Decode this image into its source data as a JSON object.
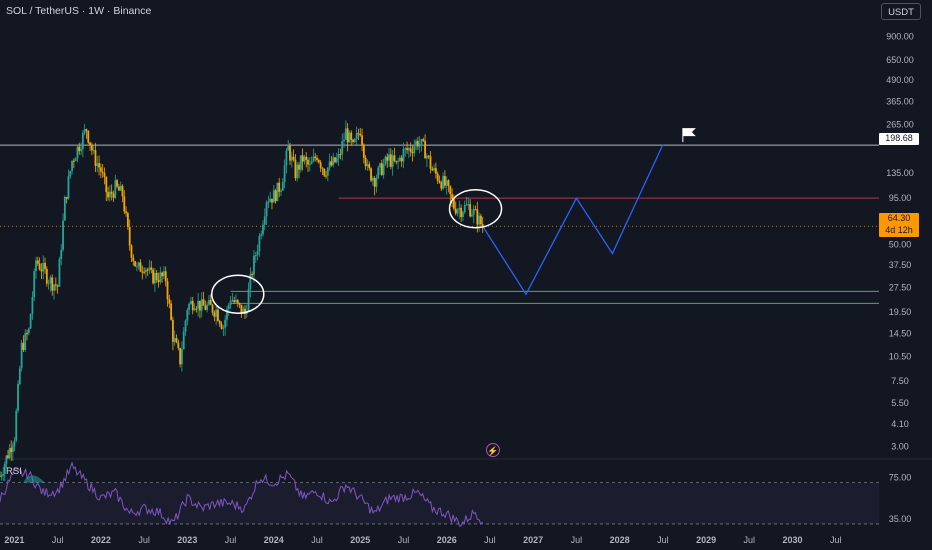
{
  "header": {
    "title": "SOL / TetherUS · 1W · Binance",
    "currency_button": "USDT"
  },
  "indicator": {
    "rsi_label": "RSI"
  },
  "price_tags": {
    "level": "198.68",
    "last": "64.30",
    "countdown": "4d 12h"
  },
  "price_axis": [
    "900.00",
    "650.00",
    "490.00",
    "365.00",
    "265.00",
    "198.68",
    "135.00",
    "95.00",
    "70.00",
    "50.00",
    "37.50",
    "27.50",
    "19.50",
    "14.50",
    "10.50",
    "7.50",
    "5.50",
    "4.10",
    "3.00"
  ],
  "rsi_axis": [
    "75.00",
    "35.00"
  ],
  "time_axis": [
    "2021",
    "Jul",
    "2022",
    "Jul",
    "2023",
    "Jul",
    "2024",
    "Jul",
    "2025",
    "Jul",
    "2026",
    "Jul",
    "2027",
    "Jul",
    "2028",
    "Jul",
    "2029",
    "Jul",
    "2030",
    "Jul"
  ],
  "colors": {
    "background": "#131722",
    "up": "#26a69a",
    "down": "#f7a600",
    "projection": "#2962ff",
    "resistance": "#b2384d",
    "support": "#4caf50",
    "rsi": "#7e57c2",
    "level_line": "#b2b5be"
  },
  "chart_data": {
    "type": "candlestick",
    "symbol": "SOL / TetherUS",
    "interval": "1W",
    "exchange": "Binance",
    "scale": "log",
    "price_ylim": [
      2.6,
      1100
    ],
    "x_range": [
      "2020-11",
      "2031-01"
    ],
    "series": [
      {
        "name": "SOL / TetherUS",
        "points": [
          [
            "2020-11",
            2.0
          ],
          [
            "2021-01",
            3.5
          ],
          [
            "2021-02",
            12
          ],
          [
            "2021-03",
            15
          ],
          [
            "2021-04",
            40
          ],
          [
            "2021-05",
            35
          ],
          [
            "2021-06",
            30
          ],
          [
            "2021-07",
            28
          ],
          [
            "2021-08",
            90
          ],
          [
            "2021-09",
            160
          ],
          [
            "2021-10",
            200
          ],
          [
            "2021-11",
            250
          ],
          [
            "2021-12",
            170
          ],
          [
            "2022-01",
            140
          ],
          [
            "2022-02",
            95
          ],
          [
            "2022-03",
            110
          ],
          [
            "2022-04",
            100
          ],
          [
            "2022-05",
            50
          ],
          [
            "2022-06",
            35
          ],
          [
            "2022-07",
            38
          ],
          [
            "2022-08",
            32
          ],
          [
            "2022-09",
            32
          ],
          [
            "2022-10",
            31
          ],
          [
            "2022-11",
            14
          ],
          [
            "2022-12",
            10
          ],
          [
            "2023-01",
            21
          ],
          [
            "2023-02",
            23
          ],
          [
            "2023-03",
            21
          ],
          [
            "2023-04",
            21
          ],
          [
            "2023-05",
            20
          ],
          [
            "2023-06",
            16
          ],
          [
            "2023-07",
            24
          ],
          [
            "2023-08",
            21
          ],
          [
            "2023-09",
            19
          ],
          [
            "2023-10",
            35
          ],
          [
            "2023-11",
            55
          ],
          [
            "2023-12",
            95
          ],
          [
            "2024-01",
            98
          ],
          [
            "2024-02",
            115
          ],
          [
            "2024-03",
            190
          ],
          [
            "2024-04",
            135
          ],
          [
            "2024-05",
            165
          ],
          [
            "2024-06",
            145
          ],
          [
            "2024-07",
            175
          ],
          [
            "2024-08",
            140
          ],
          [
            "2024-09",
            150
          ],
          [
            "2024-10",
            165
          ],
          [
            "2024-11",
            240
          ],
          [
            "2024-12",
            190
          ],
          [
            "2025-01",
            250
          ],
          [
            "2025-02",
            140
          ],
          [
            "2025-03",
            125
          ],
          [
            "2025-04",
            145
          ],
          [
            "2025-05",
            165
          ],
          [
            "2025-06",
            150
          ],
          [
            "2025-07",
            180
          ],
          [
            "2025-08",
            190
          ],
          [
            "2025-09",
            210
          ],
          [
            "2025-10",
            185
          ],
          [
            "2025-11",
            140
          ],
          [
            "2025-12",
            125
          ],
          [
            "2026-01",
            110
          ],
          [
            "2026-02",
            85
          ],
          [
            "2026-03",
            82
          ],
          [
            "2026-04",
            85
          ],
          [
            "2026-05",
            75
          ],
          [
            "2026-06",
            64.3
          ]
        ]
      }
    ],
    "horizontal_levels": [
      {
        "value": 198.68,
        "from": "2020-11",
        "to": "2031-01"
      },
      {
        "value": 95,
        "from": "2024-10",
        "to": "2031-01"
      },
      {
        "value": 26,
        "from": "2023-07",
        "to": "2031-01"
      },
      {
        "value": 22,
        "from": "2023-07",
        "to": "2031-01"
      }
    ],
    "projection": [
      [
        "2026-06",
        64.3
      ],
      [
        "2026-12",
        25
      ],
      [
        "2027-07",
        95
      ],
      [
        "2027-12",
        44
      ],
      [
        "2028-07",
        200
      ]
    ],
    "highlight_circles": [
      {
        "center": [
          "2023-08",
          25
        ]
      },
      {
        "center": [
          "2026-05",
          82
        ]
      }
    ],
    "flag": [
      "2028-07",
      225
    ],
    "rsi": {
      "ylim": [
        28,
        90
      ],
      "levels": [
        70,
        30
      ],
      "values": [
        [
          "2020-11",
          55
        ],
        [
          "2021-01",
          80
        ],
        [
          "2021-03",
          78
        ],
        [
          "2021-05",
          60
        ],
        [
          "2021-07",
          62
        ],
        [
          "2021-09",
          85
        ],
        [
          "2021-11",
          70
        ],
        [
          "2022-01",
          55
        ],
        [
          "2022-03",
          60
        ],
        [
          "2022-05",
          40
        ],
        [
          "2022-07",
          45
        ],
        [
          "2022-09",
          42
        ],
        [
          "2022-11",
          30
        ],
        [
          "2023-01",
          55
        ],
        [
          "2023-03",
          45
        ],
        [
          "2023-05",
          50
        ],
        [
          "2023-07",
          50
        ],
        [
          "2023-09",
          45
        ],
        [
          "2023-11",
          75
        ],
        [
          "2024-01",
          70
        ],
        [
          "2024-03",
          78
        ],
        [
          "2024-05",
          55
        ],
        [
          "2024-07",
          62
        ],
        [
          "2024-09",
          50
        ],
        [
          "2024-11",
          68
        ],
        [
          "2025-01",
          55
        ],
        [
          "2025-03",
          40
        ],
        [
          "2025-05",
          55
        ],
        [
          "2025-07",
          56
        ],
        [
          "2025-09",
          60
        ],
        [
          "2025-11",
          45
        ],
        [
          "2026-01",
          40
        ],
        [
          "2026-03",
          30
        ],
        [
          "2026-05",
          42
        ],
        [
          "2026-06",
          32
        ]
      ]
    }
  }
}
